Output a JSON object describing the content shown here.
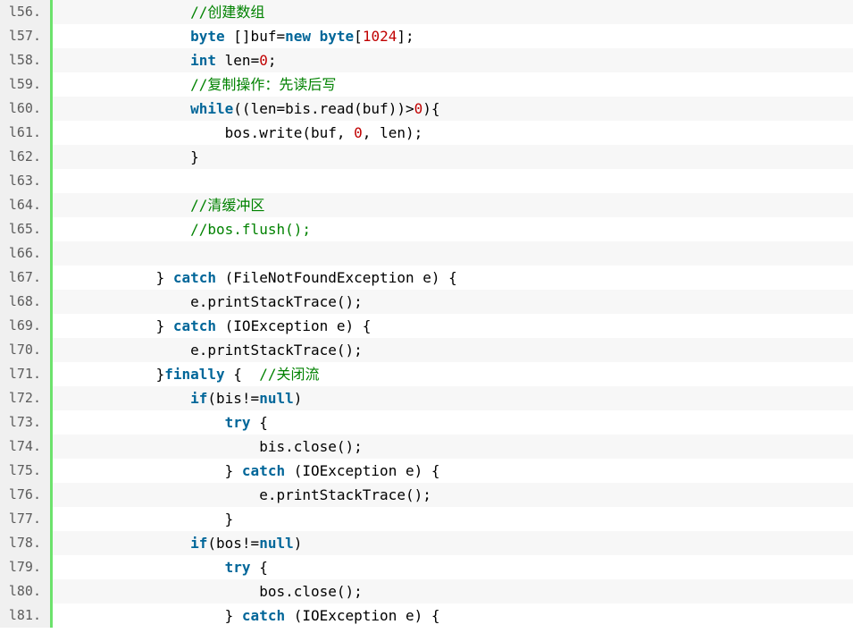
{
  "colors": {
    "keyword": "#006699",
    "comment": "#008200",
    "number": "#c00000",
    "gutter_border": "#6ce26c"
  },
  "lines": [
    {
      "num": "l56.",
      "indent": "                ",
      "tokens": [
        {
          "t": "cm",
          "v": "//创建数组"
        }
      ]
    },
    {
      "num": "l57.",
      "indent": "                ",
      "tokens": [
        {
          "t": "kw",
          "v": "byte"
        },
        {
          "t": "pl",
          "v": " []buf="
        },
        {
          "t": "kw",
          "v": "new"
        },
        {
          "t": "pl",
          "v": " "
        },
        {
          "t": "kw",
          "v": "byte"
        },
        {
          "t": "pl",
          "v": "["
        },
        {
          "t": "num",
          "v": "1024"
        },
        {
          "t": "pl",
          "v": "];"
        }
      ]
    },
    {
      "num": "l58.",
      "indent": "                ",
      "tokens": [
        {
          "t": "kw",
          "v": "int"
        },
        {
          "t": "pl",
          "v": " len="
        },
        {
          "t": "num",
          "v": "0"
        },
        {
          "t": "pl",
          "v": ";"
        }
      ]
    },
    {
      "num": "l59.",
      "indent": "                ",
      "tokens": [
        {
          "t": "cm",
          "v": "//复制操作：先读后写"
        }
      ]
    },
    {
      "num": "l60.",
      "indent": "                ",
      "tokens": [
        {
          "t": "kw",
          "v": "while"
        },
        {
          "t": "pl",
          "v": "((len=bis.read(buf))>"
        },
        {
          "t": "num",
          "v": "0"
        },
        {
          "t": "pl",
          "v": "){"
        }
      ]
    },
    {
      "num": "l61.",
      "indent": "                    ",
      "tokens": [
        {
          "t": "pl",
          "v": "bos.write(buf, "
        },
        {
          "t": "num",
          "v": "0"
        },
        {
          "t": "pl",
          "v": ", len);"
        }
      ]
    },
    {
      "num": "l62.",
      "indent": "                ",
      "tokens": [
        {
          "t": "pl",
          "v": "}"
        }
      ]
    },
    {
      "num": "l63.",
      "indent": "",
      "tokens": []
    },
    {
      "num": "l64.",
      "indent": "                ",
      "tokens": [
        {
          "t": "cm",
          "v": "//清缓冲区"
        }
      ]
    },
    {
      "num": "l65.",
      "indent": "                ",
      "tokens": [
        {
          "t": "cm",
          "v": "//bos.flush();"
        }
      ]
    },
    {
      "num": "l66.",
      "indent": "",
      "tokens": []
    },
    {
      "num": "l67.",
      "indent": "            ",
      "tokens": [
        {
          "t": "pl",
          "v": "} "
        },
        {
          "t": "kw",
          "v": "catch"
        },
        {
          "t": "pl",
          "v": " (FileNotFoundException e) {"
        }
      ]
    },
    {
      "num": "l68.",
      "indent": "                ",
      "tokens": [
        {
          "t": "pl",
          "v": "e.printStackTrace();"
        }
      ]
    },
    {
      "num": "l69.",
      "indent": "            ",
      "tokens": [
        {
          "t": "pl",
          "v": "} "
        },
        {
          "t": "kw",
          "v": "catch"
        },
        {
          "t": "pl",
          "v": " (IOException e) {"
        }
      ]
    },
    {
      "num": "l70.",
      "indent": "                ",
      "tokens": [
        {
          "t": "pl",
          "v": "e.printStackTrace();"
        }
      ]
    },
    {
      "num": "l71.",
      "indent": "            ",
      "tokens": [
        {
          "t": "pl",
          "v": "}"
        },
        {
          "t": "kw",
          "v": "finally"
        },
        {
          "t": "pl",
          "v": " {  "
        },
        {
          "t": "cm",
          "v": "//关闭流"
        }
      ]
    },
    {
      "num": "l72.",
      "indent": "                ",
      "tokens": [
        {
          "t": "kw",
          "v": "if"
        },
        {
          "t": "pl",
          "v": "(bis!="
        },
        {
          "t": "kw",
          "v": "null"
        },
        {
          "t": "pl",
          "v": ")"
        }
      ]
    },
    {
      "num": "l73.",
      "indent": "                    ",
      "tokens": [
        {
          "t": "kw",
          "v": "try"
        },
        {
          "t": "pl",
          "v": " {"
        }
      ]
    },
    {
      "num": "l74.",
      "indent": "                        ",
      "tokens": [
        {
          "t": "pl",
          "v": "bis.close();"
        }
      ]
    },
    {
      "num": "l75.",
      "indent": "                    ",
      "tokens": [
        {
          "t": "pl",
          "v": "} "
        },
        {
          "t": "kw",
          "v": "catch"
        },
        {
          "t": "pl",
          "v": " (IOException e) {"
        }
      ]
    },
    {
      "num": "l76.",
      "indent": "                        ",
      "tokens": [
        {
          "t": "pl",
          "v": "e.printStackTrace();"
        }
      ]
    },
    {
      "num": "l77.",
      "indent": "                    ",
      "tokens": [
        {
          "t": "pl",
          "v": "}"
        }
      ]
    },
    {
      "num": "l78.",
      "indent": "                ",
      "tokens": [
        {
          "t": "kw",
          "v": "if"
        },
        {
          "t": "pl",
          "v": "(bos!="
        },
        {
          "t": "kw",
          "v": "null"
        },
        {
          "t": "pl",
          "v": ")"
        }
      ]
    },
    {
      "num": "l79.",
      "indent": "                    ",
      "tokens": [
        {
          "t": "kw",
          "v": "try"
        },
        {
          "t": "pl",
          "v": " {"
        }
      ]
    },
    {
      "num": "l80.",
      "indent": "                        ",
      "tokens": [
        {
          "t": "pl",
          "v": "bos.close();"
        }
      ]
    },
    {
      "num": "l81.",
      "indent": "                    ",
      "tokens": [
        {
          "t": "pl",
          "v": "} "
        },
        {
          "t": "kw",
          "v": "catch"
        },
        {
          "t": "pl",
          "v": " (IOException e) {"
        }
      ]
    }
  ]
}
